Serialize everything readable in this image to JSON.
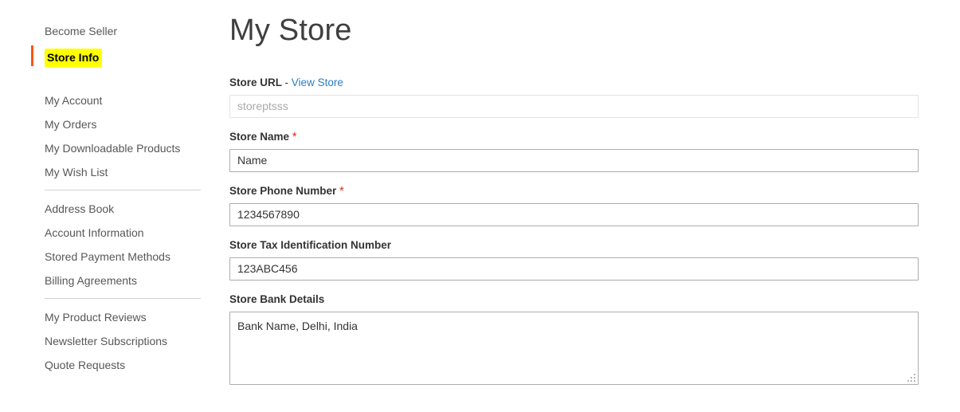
{
  "sidebar": {
    "groups": [
      {
        "items": [
          {
            "label": "Become Seller",
            "current": false,
            "name": "become-seller"
          },
          {
            "label": "Store Info",
            "current": true,
            "name": "store-info"
          }
        ]
      },
      {
        "items": [
          {
            "label": "My Account",
            "current": false,
            "name": "my-account"
          },
          {
            "label": "My Orders",
            "current": false,
            "name": "my-orders"
          },
          {
            "label": "My Downloadable Products",
            "current": false,
            "name": "my-downloadable-products"
          },
          {
            "label": "My Wish List",
            "current": false,
            "name": "my-wish-list"
          }
        ]
      },
      {
        "items": [
          {
            "label": "Address Book",
            "current": false,
            "name": "address-book"
          },
          {
            "label": "Account Information",
            "current": false,
            "name": "account-information"
          },
          {
            "label": "Stored Payment Methods",
            "current": false,
            "name": "stored-payment-methods"
          },
          {
            "label": "Billing Agreements",
            "current": false,
            "name": "billing-agreements"
          }
        ]
      },
      {
        "items": [
          {
            "label": "My Product Reviews",
            "current": false,
            "name": "my-product-reviews"
          },
          {
            "label": "Newsletter Subscriptions",
            "current": false,
            "name": "newsletter-subscriptions"
          },
          {
            "label": "Quote Requests",
            "current": false,
            "name": "quote-requests"
          }
        ]
      }
    ]
  },
  "main": {
    "title": "My Store",
    "store_url": {
      "label": "Store URL",
      "separator": "-",
      "link_label": "View Store",
      "value": "",
      "placeholder": "storeptsss"
    },
    "store_name": {
      "label": "Store Name",
      "required_mark": "*",
      "value": "Name",
      "placeholder": ""
    },
    "store_phone": {
      "label": "Store Phone Number",
      "required_mark": "*",
      "value": "1234567890",
      "placeholder": ""
    },
    "store_tax_id": {
      "label": "Store Tax Identification Number",
      "value": "123ABC456",
      "placeholder": ""
    },
    "store_bank_details": {
      "label": "Store Bank Details",
      "value": "Bank Name, Delhi, India",
      "placeholder": ""
    }
  },
  "colors": {
    "accent_orange": "#ff5501",
    "highlight_yellow": "#ffff00",
    "link_blue": "#2b7ec1",
    "required_red": "#e02b27",
    "text": "#333333",
    "muted_text": "#575757",
    "border": "#adadad"
  }
}
